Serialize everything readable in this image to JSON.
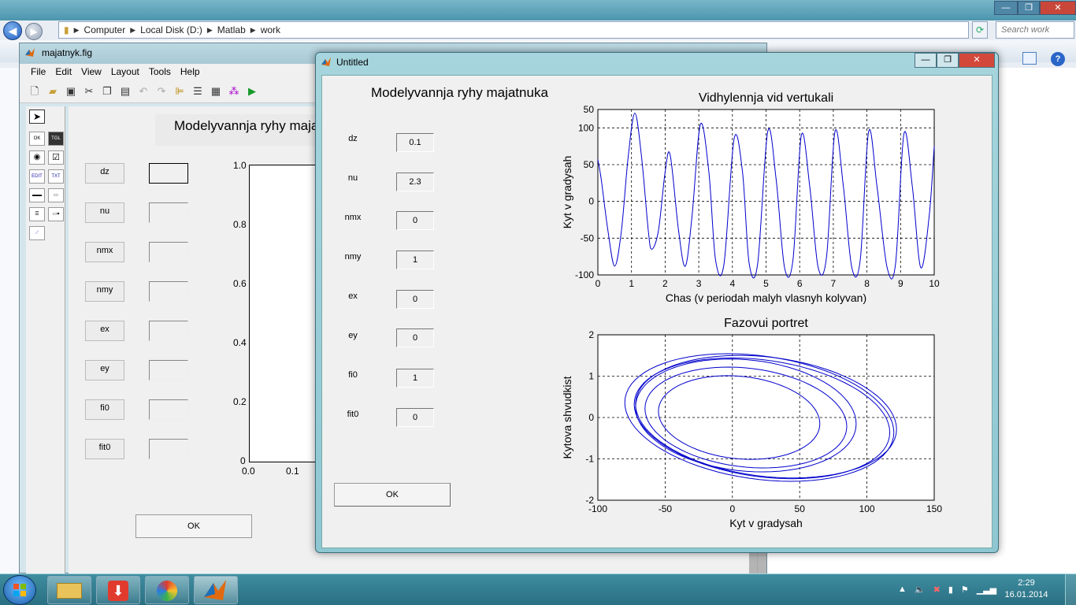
{
  "explorer": {
    "breadcrumb": [
      "Computer",
      "Local Disk (D:)",
      "Matlab",
      "work"
    ],
    "search_placeholder": "Search work"
  },
  "guide": {
    "window_title": "majatnyk.fig",
    "menu": [
      "File",
      "Edit",
      "View",
      "Layout",
      "Tools",
      "Help"
    ],
    "title_text": "Modelyvannja ryhy majatnuka",
    "labels": [
      "dz",
      "nu",
      "nmx",
      "nmy",
      "ex",
      "ey",
      "fi0",
      "fit0"
    ],
    "ok_label": "OK",
    "axis_yticks": [
      "1.0",
      "0.8",
      "0.6",
      "0.4",
      "0.2",
      "0"
    ],
    "axis_xticks": [
      "0.0",
      "0.1"
    ]
  },
  "figure": {
    "window_title": "Untitled",
    "title_text": "Modelyvannja ryhy majatnuka",
    "params": [
      {
        "label": "dz",
        "value": "0.1"
      },
      {
        "label": "nu",
        "value": "2.3"
      },
      {
        "label": "nmx",
        "value": "0"
      },
      {
        "label": "nmy",
        "value": "1"
      },
      {
        "label": "ex",
        "value": "0"
      },
      {
        "label": "ey",
        "value": "0"
      },
      {
        "label": "fi0",
        "value": "1"
      },
      {
        "label": "fit0",
        "value": "0"
      }
    ],
    "ok_label": "OK"
  },
  "chart_data": [
    {
      "type": "line",
      "title": "Vidhylennja vid vertukali",
      "xlabel": "Chas (v periodah malyh vlasnyh kolyvan)",
      "ylabel": "Kyt v gradysah",
      "xlim": [
        0,
        10
      ],
      "ylim": [
        -100,
        50
      ],
      "xticks": [
        "0",
        "1",
        "2",
        "3",
        "4",
        "5",
        "6",
        "7",
        "8",
        "9",
        "10"
      ],
      "yticks": [
        "50",
        "100",
        "50",
        "0",
        "-50",
        "-100"
      ],
      "ytick_values": [
        125,
        100,
        50,
        0,
        -50,
        -100
      ],
      "grid": true,
      "color": "#0000cc",
      "series": [
        {
          "x": [
            0,
            0.1,
            0.3,
            0.5,
            0.7,
            0.9,
            1.1,
            1.3,
            1.5,
            1.6,
            1.8,
            2.0,
            2.15,
            2.4,
            2.6,
            2.8,
            3.05,
            3.3,
            3.5,
            3.75,
            4.05,
            4.3,
            4.5,
            4.75,
            5.05,
            5.3,
            5.55,
            5.8,
            6.05,
            6.3,
            6.55,
            6.8,
            7.05,
            7.3,
            7.55,
            7.8,
            8.05,
            8.3,
            8.6,
            8.85,
            9.1,
            9.35,
            9.6,
            9.85,
            10
          ],
          "y": [
            57,
            30,
            -40,
            -88,
            -40,
            60,
            120,
            60,
            -40,
            -65,
            -40,
            40,
            63,
            -40,
            -88,
            -20,
            105,
            40,
            -80,
            -85,
            85,
            40,
            -85,
            -85,
            95,
            30,
            -90,
            -80,
            90,
            20,
            -90,
            -75,
            95,
            20,
            -90,
            -80,
            95,
            20,
            -90,
            -85,
            92,
            20,
            -90,
            -20,
            75
          ]
        }
      ]
    },
    {
      "type": "line",
      "title": "Fazovui portret",
      "xlabel": "Kyt v gradysah",
      "ylabel": "Kytova shvudkist",
      "xlim": [
        -100,
        150
      ],
      "ylim": [
        -2,
        2
      ],
      "xticks": [
        "-100",
        "-50",
        "0",
        "50",
        "100",
        "150"
      ],
      "yticks": [
        "2",
        "1",
        "0",
        "-1",
        "-2"
      ],
      "grid": true,
      "color": "#0000cc",
      "series": [
        {
          "loops": [
            {
              "cx": 5,
              "cy": 0,
              "rx": 60,
              "ry": 1.0,
              "tilt": -0.05
            },
            {
              "cx": 10,
              "cy": 0,
              "rx": 75,
              "ry": 1.2,
              "tilt": -0.06
            },
            {
              "cx": 20,
              "cy": 0,
              "rx": 100,
              "ry": 1.5,
              "tilt": -0.08
            },
            {
              "cx": 25,
              "cy": 0.02,
              "rx": 97,
              "ry": 1.45,
              "tilt": -0.07
            },
            {
              "cx": 22,
              "cy": -0.02,
              "rx": 95,
              "ry": 1.42,
              "tilt": -0.08
            },
            {
              "cx": 10,
              "cy": 0.05,
              "rx": 82,
              "ry": 1.35,
              "tilt": -0.05
            }
          ]
        }
      ]
    }
  ]
}
